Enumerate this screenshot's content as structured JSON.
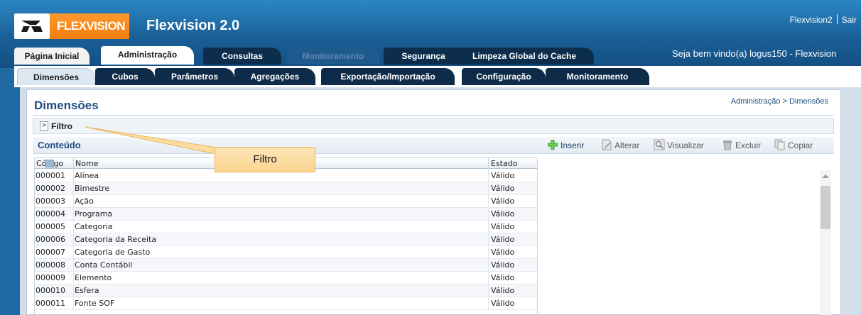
{
  "header": {
    "brand": "FLEXVISION",
    "app_title": "Flexvision 2.0",
    "user_link": "Flexvision2",
    "logout_link": "Sair",
    "welcome": "Seja bem vindo(a) logus150 - Flexvision"
  },
  "main_tabs": [
    {
      "label": "Página Inicial",
      "state": "light"
    },
    {
      "label": "Administração",
      "state": "active"
    },
    {
      "label": "Consultas",
      "state": "normal"
    },
    {
      "label": "Monitoramento",
      "state": "disabled"
    },
    {
      "label": "Segurança",
      "state": "normal"
    },
    {
      "label": "Limpeza Global do Cache",
      "state": "normal"
    }
  ],
  "sub_tabs": [
    {
      "label": "Dimensões",
      "state": "active"
    },
    {
      "label": "Cubos",
      "state": "normal"
    },
    {
      "label": "Parâmetros",
      "state": "normal"
    },
    {
      "label": "Agregações",
      "state": "normal"
    },
    {
      "label": "Exportação/Importação",
      "state": "normal"
    },
    {
      "label": "Configuração",
      "state": "normal"
    },
    {
      "label": "Monitoramento",
      "state": "normal"
    }
  ],
  "panel": {
    "title": "Dimensões",
    "breadcrumb": "Administração > Dimensões",
    "filter_label": "Filtro",
    "filter_toggle": ">",
    "content_title": "Conteúdo"
  },
  "toolbar": {
    "insert": "Inserir",
    "edit": "Alterar",
    "view": "Visualizar",
    "delete": "Excluir",
    "copy": "Copiar"
  },
  "table": {
    "columns": {
      "code": "Código",
      "name": "Nome",
      "state": "Estado"
    },
    "rows": [
      {
        "code": "000001",
        "name": "Alínea",
        "state": "Válido"
      },
      {
        "code": "000002",
        "name": "Bimestre",
        "state": "Válido"
      },
      {
        "code": "000003",
        "name": "Ação",
        "state": "Válido"
      },
      {
        "code": "000004",
        "name": "Programa",
        "state": "Válido"
      },
      {
        "code": "000005",
        "name": "Categoria",
        "state": "Válido"
      },
      {
        "code": "000006",
        "name": "Categoria da Receita",
        "state": "Válido"
      },
      {
        "code": "000007",
        "name": "Categoria de Gasto",
        "state": "Válido"
      },
      {
        "code": "000008",
        "name": "Conta Contábil",
        "state": "Válido"
      },
      {
        "code": "000009",
        "name": "Elemento",
        "state": "Válido"
      },
      {
        "code": "000010",
        "name": "Esfera",
        "state": "Válido"
      },
      {
        "code": "000011",
        "name": "Fonte SOF",
        "state": "Válido"
      }
    ]
  },
  "callout": {
    "text": "Filtro"
  },
  "colors": {
    "header_blue": "#1a5f97",
    "dark_tab": "#0d2d4d",
    "brand_orange": "#f07d0c",
    "title_blue": "#1d4e80",
    "callout_fill": "#fbd48f"
  }
}
